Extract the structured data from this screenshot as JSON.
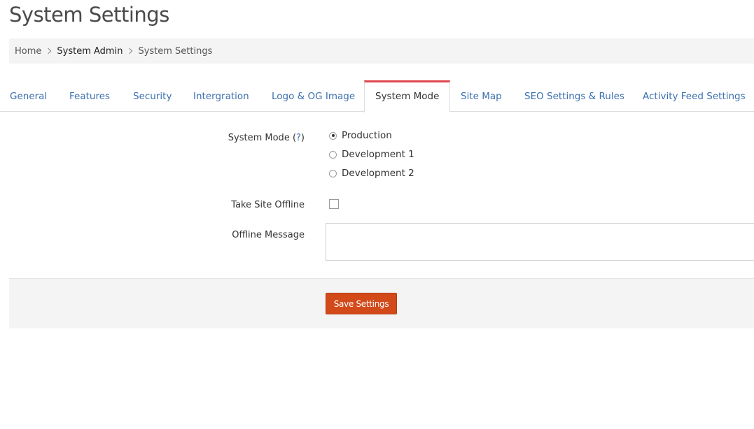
{
  "page": {
    "title": "System Settings"
  },
  "breadcrumb": {
    "items": [
      "Home",
      "System Admin",
      "System Settings"
    ]
  },
  "tabs": [
    {
      "label": "General"
    },
    {
      "label": "Features"
    },
    {
      "label": "Security"
    },
    {
      "label": "Intergration"
    },
    {
      "label": "Logo & OG Image"
    },
    {
      "label": "System Mode",
      "active": true
    },
    {
      "label": "Site Map"
    },
    {
      "label": "SEO Settings & Rules"
    },
    {
      "label": "Activity Feed Settings"
    }
  ],
  "form": {
    "system_mode": {
      "label": "System Mode (",
      "help": "?",
      "label_end": ")",
      "options": [
        {
          "label": "Production",
          "checked": true
        },
        {
          "label": "Development 1",
          "checked": false
        },
        {
          "label": "Development 2",
          "checked": false
        }
      ]
    },
    "offline": {
      "label": "Take Site Offline",
      "checked": false
    },
    "offline_message": {
      "label": "Offline Message",
      "value": ""
    }
  },
  "footer": {
    "save_label": "Save Settings"
  },
  "colors": {
    "accent": "#d24a1a",
    "link": "#3b6fae",
    "active_tab_border": "#e0464e"
  }
}
